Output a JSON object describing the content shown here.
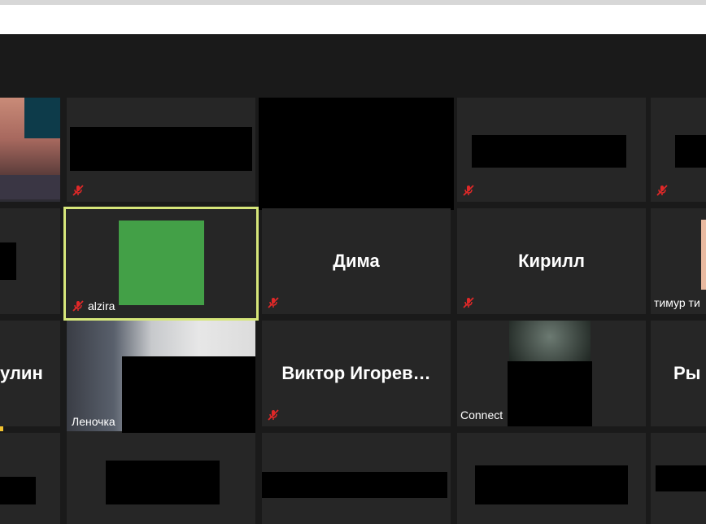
{
  "gallery": {
    "tiles": {
      "alzira": "alzira",
      "dima": "Дима",
      "kirill": "Кирилл",
      "timur": "тимур ти",
      "ulin": "улин",
      "lenochka": "Леночка",
      "viktor": "Виктор  Игорев…",
      "connect": "Connect",
      "ry": "Ры"
    }
  },
  "colors": {
    "background": "#1a1a1a",
    "tile": "#262626",
    "active_speaker_border": "#d6e67a",
    "mute_icon": "#e02828",
    "avatar_green": "#43a047"
  }
}
